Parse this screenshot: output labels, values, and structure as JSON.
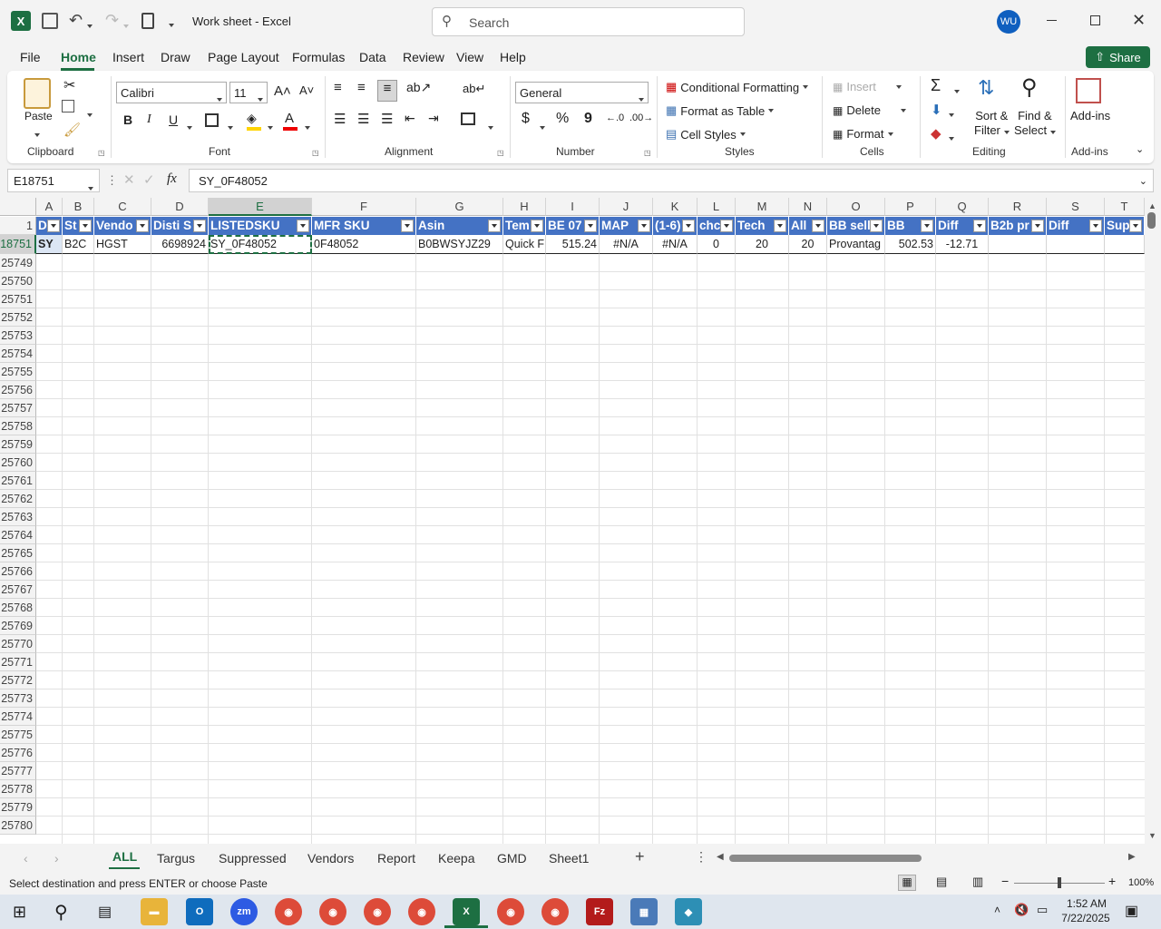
{
  "title": "Work sheet  -  Excel",
  "search_placeholder": "Search",
  "user_initials": "WU",
  "share_label": "Share",
  "ribbon_tabs": [
    "File",
    "Home",
    "Insert",
    "Draw",
    "Page Layout",
    "Formulas",
    "Data",
    "Review",
    "View",
    "Help"
  ],
  "clipboard": {
    "paste": "Paste",
    "label": "Clipboard"
  },
  "font": {
    "name": "Calibri",
    "size": "11",
    "label": "Font",
    "bold": "B",
    "italic": "I",
    "underline": "U"
  },
  "alignment": {
    "label": "Alignment"
  },
  "number": {
    "format": "General",
    "label": "Number",
    "currency": "$",
    "percent": "%",
    "comma": "9"
  },
  "styles": {
    "cond": "Conditional Formatting",
    "table": "Format as Table",
    "cell": "Cell Styles",
    "label": "Styles"
  },
  "cells": {
    "insert": "Insert",
    "delete": "Delete",
    "format": "Format",
    "label": "Cells"
  },
  "editing": {
    "sort1": "Sort &",
    "sort2": "Filter",
    "find1": "Find &",
    "find2": "Select",
    "label": "Editing"
  },
  "addins": {
    "btn": "Add-ins",
    "label": "Add-ins"
  },
  "namebox": "E18751",
  "fx": "fx",
  "formula": "SY_0F48052",
  "columns": [
    "A",
    "B",
    "C",
    "D",
    "E",
    "F",
    "G",
    "H",
    "I",
    "J",
    "K",
    "L",
    "M",
    "N",
    "O",
    "P",
    "Q",
    "R",
    "S",
    "T"
  ],
  "header_row_num": "1",
  "headers": [
    "D",
    "St",
    "Vendo",
    "Disti S",
    "LISTEDSKU",
    "MFR SKU",
    "Asin",
    "Tem",
    "BE 07",
    "MAP",
    "(1-6)",
    "chc",
    "Tech",
    "All",
    "BB sell",
    "BB",
    "Diff",
    "B2b pr",
    "Diff",
    "Sup"
  ],
  "data_row_num": "18751",
  "data_row": [
    "SY",
    "B2C",
    "HGST",
    "6698924",
    "SY_0F48052",
    "0F48052",
    "B0BWSYJZ29",
    "Quick F",
    "515.24",
    "#N/A",
    "#N/A",
    "0",
    "20",
    "20",
    "Provantag",
    "502.53",
    "-12.71",
    "",
    "",
    ""
  ],
  "row_numbers": [
    "25749",
    "25750",
    "25751",
    "25752",
    "25753",
    "25754",
    "25755",
    "25756",
    "25757",
    "25758",
    "25759",
    "25760",
    "25761",
    "25762",
    "25763",
    "25764",
    "25765",
    "25766",
    "25767",
    "25768",
    "25769",
    "25770",
    "25771",
    "25772",
    "25773",
    "25774",
    "25775",
    "25776",
    "25777",
    "25778",
    "25779",
    "25780"
  ],
  "sheets": [
    "ALL",
    "Targus",
    "Suppressed",
    "Vendors",
    "Report",
    "Keepa",
    "GMD",
    "Sheet1"
  ],
  "status": "Select destination and press ENTER or choose Paste",
  "zoom": "100%",
  "clock_time": "1:52 AM",
  "clock_date": "7/22/2025",
  "accent": "#217346",
  "header_blue": "#4472c4"
}
